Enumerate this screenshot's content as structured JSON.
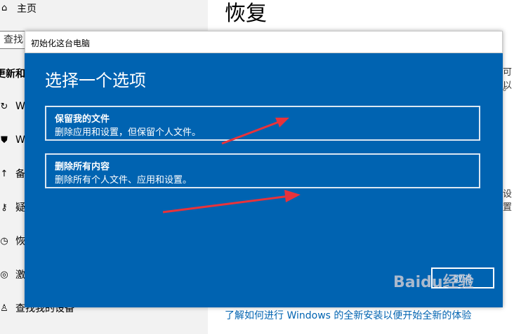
{
  "settings": {
    "home_label": "主页",
    "search_placeholder": "查找",
    "section_header": "更新和",
    "nav_items": [
      {
        "label": "W",
        "icon": "refresh-icon"
      },
      {
        "label": "W",
        "icon": "shield-icon"
      },
      {
        "label": "备",
        "icon": "backup-icon"
      },
      {
        "label": "疑",
        "icon": "key-icon"
      },
      {
        "label": "恢",
        "icon": "history-icon"
      },
      {
        "label": "激",
        "icon": "check-circle-icon"
      },
      {
        "label": "查找我的设备",
        "icon": "person-icon"
      }
    ],
    "page_title": "恢复",
    "right_fragments": [
      "可以",
      "。",
      "设置"
    ],
    "bottom_link": "了解如何进行 Windows 的全新安装以便开始全新的体验"
  },
  "dialog": {
    "title": "初始化这台电脑",
    "heading": "选择一个选项",
    "options": [
      {
        "title": "保留我的文件",
        "description": "删除应用和设置，但保留个人文件。"
      },
      {
        "title": "删除所有内容",
        "description": "删除所有个人文件、应用和设置。"
      }
    ],
    "cancel_label": "取消"
  },
  "watermark": "Baidu经验",
  "colors": {
    "dialog_bg": "#0063b1",
    "annotation_arrow": "#e8333b",
    "link": "#0063b1"
  }
}
